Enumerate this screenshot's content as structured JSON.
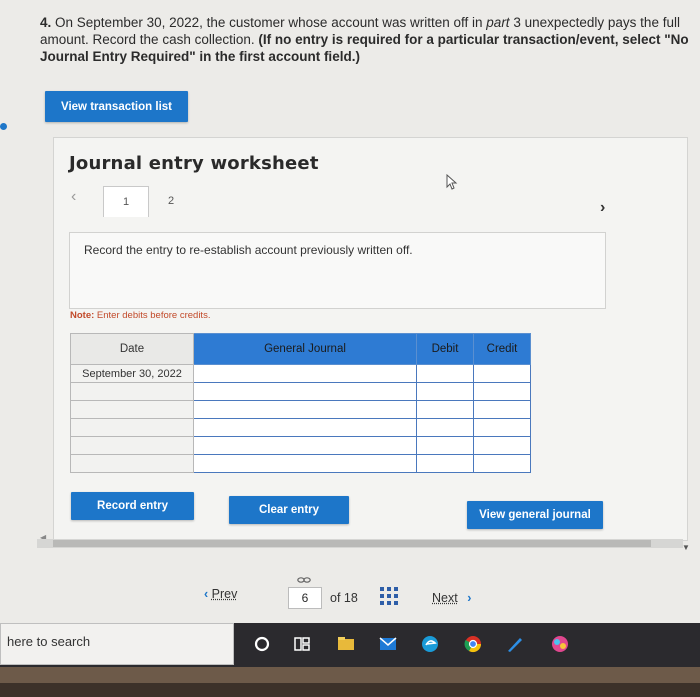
{
  "question": {
    "number": "4.",
    "text_part1": "On September 30, 2022, the customer whose account was written off in",
    "part_ref": "part",
    "part_num": "3",
    "text_part2": "unexpectedly pays the full amount. Record the cash collection.",
    "bold_instruction": "(If no entry is required for a particular transaction/event, select \"No Journal Entry Required\" in the first account field.)"
  },
  "buttons": {
    "view_transaction_list": "View transaction list",
    "record_entry": "Record entry",
    "clear_entry": "Clear entry",
    "view_general_journal": "View general journal"
  },
  "worksheet": {
    "title": "Journal entry worksheet",
    "tabs": [
      "1",
      "2"
    ],
    "active_tab": "1",
    "instruction": "Record the entry to re-establish account previously written off.",
    "note_label": "Note:",
    "note_text": "Enter debits before credits."
  },
  "table": {
    "headers": {
      "date": "Date",
      "general_journal": "General Journal",
      "debit": "Debit",
      "credit": "Credit"
    },
    "first_date": "September 30, 2022",
    "row_count": 6
  },
  "pager": {
    "prev": "Prev",
    "current": "6",
    "of_label": "of 18",
    "next": "Next"
  },
  "taskbar": {
    "search_placeholder": "here to search"
  },
  "colors": {
    "accent_blue": "#1d76c9",
    "table_header_blue": "#2e7bd3",
    "note_red": "#c24a2a"
  }
}
